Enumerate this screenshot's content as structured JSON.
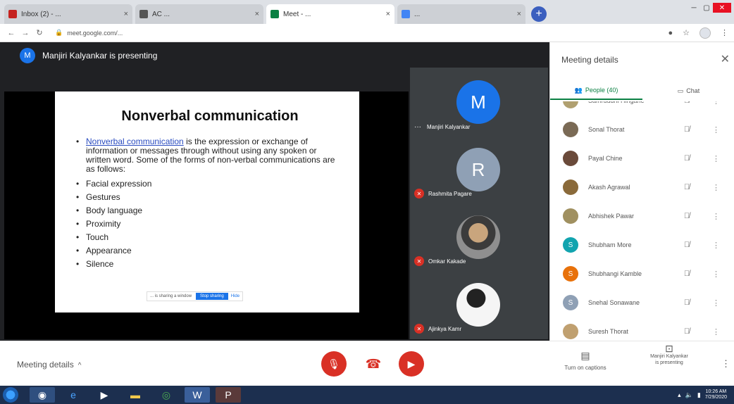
{
  "browser": {
    "tabs": [
      {
        "label": "Inbox (2) - ...",
        "favicon_color": "#c5221f",
        "active": false
      },
      {
        "label": "AC ... ",
        "favicon_color": "#555555",
        "active": false
      },
      {
        "label": "Meet - ...",
        "favicon_color": "#0b8043",
        "active": true
      },
      {
        "label": "... ",
        "favicon_color": "#4285f4",
        "active": false
      }
    ],
    "url": "meet.google.com/..."
  },
  "meeting": {
    "presenter_initial": "M",
    "presenter_text": "Manjiri Kalyankar is presenting",
    "slide": {
      "title": "Nonverbal communication",
      "intro_link": "Nonverbal communication",
      "intro_text": " is the expression or exchange of information or messages through without using any spoken or written word. Some of the forms of non-verbal communications are as follows:",
      "bullets": [
        "Facial expression",
        "Gestures",
        "Body language",
        "Proximity",
        "Touch",
        "Appearance",
        "Silence"
      ]
    },
    "stop_bar": {
      "text": "... is sharing a window",
      "stop_label": "Stop sharing",
      "hide_label": "Hide"
    },
    "tiles": [
      {
        "initial": "M",
        "name": "Manjiri Kalyankar",
        "color": "#1a73e8",
        "muted": false
      },
      {
        "initial": "R",
        "name": "Rashmita Pagare",
        "color": "#8fa0b5",
        "muted": true
      },
      {
        "initial": "",
        "name": "Omkar Kakade",
        "color": "#777777",
        "muted": true
      },
      {
        "initial": "",
        "name": "Ajinkya Kamr",
        "color": "#ffffff",
        "muted": true
      }
    ]
  },
  "panel": {
    "title": "Meeting details",
    "tab_people": "People (40)",
    "tab_chat": "Chat",
    "people": [
      {
        "initial": "",
        "name": "Samruddhi Hingane",
        "color": "#b0a070"
      },
      {
        "initial": "",
        "name": "Sonal Thorat",
        "color": "#7a6a55"
      },
      {
        "initial": "",
        "name": "Payal Chine",
        "color": "#6a4a3a"
      },
      {
        "initial": "",
        "name": "Akash Agrawal",
        "color": "#8a6a3a"
      },
      {
        "initial": "",
        "name": "Abhishek Pawar",
        "color": "#a09060"
      },
      {
        "initial": "S",
        "name": "Shubham More",
        "color": "#12a4af"
      },
      {
        "initial": "S",
        "name": "Shubhangi Kamble",
        "color": "#e8710a"
      },
      {
        "initial": "S",
        "name": "Snehal Sonawane",
        "color": "#8fa0b5"
      },
      {
        "initial": "",
        "name": "Suresh Thorat",
        "color": "#c0a070"
      }
    ]
  },
  "bottom": {
    "meeting_details": "Meeting details",
    "captions": "Turn on captions",
    "presenting_name": "Manjiri Kalyankar",
    "presenting_label": "is presenting"
  },
  "taskbar": {
    "time": "10:26 AM",
    "date": "7/29/2020"
  }
}
